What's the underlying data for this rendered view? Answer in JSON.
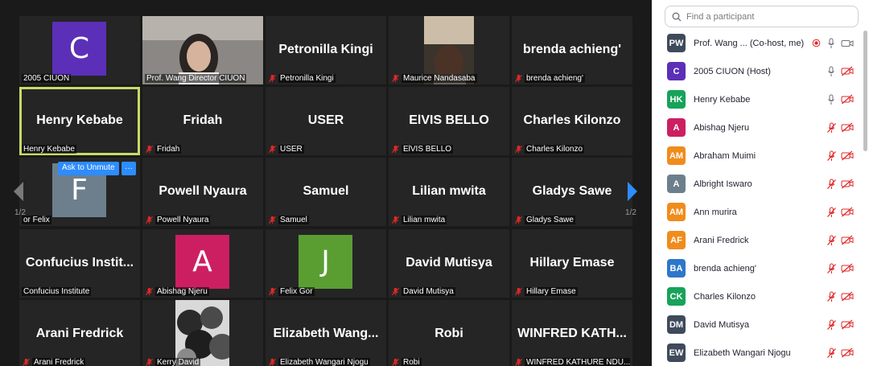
{
  "gallery": {
    "page_left": "1/2",
    "page_right": "1/2",
    "ask_to_unmute": "Ask to Unmute",
    "more": "···",
    "tiles": [
      {
        "big": "",
        "label": "2005 CIUON",
        "avatar_letter": "C",
        "avatar_color": "#5b2fb8",
        "muted": false
      },
      {
        "big": "",
        "label": "Prof. Wang Director CIUON",
        "video": true,
        "muted": false
      },
      {
        "big": "Petronilla Kingi",
        "label": "Petronilla Kingi",
        "muted": true
      },
      {
        "big": "",
        "label": "Maurice Nandasaba",
        "video": true,
        "muted": true
      },
      {
        "big": "brenda achieng'",
        "label": "brenda achieng'",
        "muted": true
      },
      {
        "big": "Henry Kebabe",
        "label": "Henry Kebabe",
        "muted": false,
        "active": true
      },
      {
        "big": "Fridah",
        "label": "Fridah",
        "muted": true
      },
      {
        "big": "USER",
        "label": "USER",
        "muted": true
      },
      {
        "big": "ElVIS BELLO",
        "label": "ElVIS BELLO",
        "muted": true
      },
      {
        "big": "Charles Kilonzo",
        "label": "Charles Kilonzo",
        "muted": true
      },
      {
        "big": "",
        "label": "or Felix",
        "avatar_letter": "F",
        "avatar_color": "#6d7f8c",
        "muted": false
      },
      {
        "big": "Powell Nyaura",
        "label": "Powell Nyaura",
        "muted": true
      },
      {
        "big": "Samuel",
        "label": "Samuel",
        "muted": true
      },
      {
        "big": "Lilian mwita",
        "label": "Lilian mwita",
        "muted": true
      },
      {
        "big": "Gladys Sawe",
        "label": "Gladys Sawe",
        "muted": true
      },
      {
        "big": "Confucius Instit...",
        "label": "Confucius Institute",
        "muted": false
      },
      {
        "big": "",
        "label": "Abishag Njeru",
        "avatar_letter": "A",
        "avatar_color": "#cc1f62",
        "muted": true
      },
      {
        "big": "",
        "label": "Felix Gor",
        "avatar_letter": "J",
        "avatar_color": "#5a9e32",
        "muted": true
      },
      {
        "big": "David Mutisya",
        "label": "David Mutisya",
        "muted": true
      },
      {
        "big": "Hillary Emase",
        "label": "Hillary Emase",
        "muted": true
      },
      {
        "big": "Arani Fredrick",
        "label": "Arani Fredrick",
        "muted": true
      },
      {
        "big": "",
        "label": "Kerry David",
        "video": true,
        "muted": true
      },
      {
        "big": "Elizabeth Wang...",
        "label": "Elizabeth Wangari Njogu",
        "muted": true
      },
      {
        "big": "Robi",
        "label": "Robi",
        "muted": true
      },
      {
        "big": "WINFRED KATH...",
        "label": "WINFRED KATHURE NDU...",
        "muted": true
      }
    ]
  },
  "panel": {
    "search_placeholder": "Find a participant",
    "participants": [
      {
        "initials": "PW",
        "color": "#3f4b5c",
        "name": "Prof. Wang ...",
        "role": "(Co-host, me)",
        "mic": "on",
        "video": "on",
        "recording": true
      },
      {
        "initials": "C",
        "color": "#5b2fb8",
        "name": "2005 CIUON (Host)",
        "role": "",
        "mic": "on",
        "video": "off"
      },
      {
        "initials": "HK",
        "color": "#16a35a",
        "name": "Henry Kebabe",
        "role": "",
        "mic": "on",
        "video": "off"
      },
      {
        "initials": "A",
        "color": "#cc1f62",
        "name": "Abishag Njeru",
        "role": "",
        "mic": "off",
        "video": "off"
      },
      {
        "initials": "AM",
        "color": "#f08c1c",
        "name": "Abraham Muimi",
        "role": "",
        "mic": "off",
        "video": "off"
      },
      {
        "initials": "A",
        "color": "#6d7f8c",
        "name": "Albright Iswaro",
        "role": "",
        "mic": "off",
        "video": "off"
      },
      {
        "initials": "AM",
        "color": "#f08c1c",
        "name": "Ann murira",
        "role": "",
        "mic": "off",
        "video": "off"
      },
      {
        "initials": "AF",
        "color": "#f08c1c",
        "name": "Arani Fredrick",
        "role": "",
        "mic": "off",
        "video": "off"
      },
      {
        "initials": "BA",
        "color": "#2e77c8",
        "name": "brenda achieng'",
        "role": "",
        "mic": "off",
        "video": "off"
      },
      {
        "initials": "CK",
        "color": "#16a35a",
        "name": "Charles Kilonzo",
        "role": "",
        "mic": "off",
        "video": "off"
      },
      {
        "initials": "DM",
        "color": "#3f4b5c",
        "name": "David Mutisya",
        "role": "",
        "mic": "off",
        "video": "off"
      },
      {
        "initials": "EW",
        "color": "#3f4b5c",
        "name": "Elizabeth Wangari Njogu",
        "role": "",
        "mic": "off",
        "video": "off"
      }
    ]
  }
}
